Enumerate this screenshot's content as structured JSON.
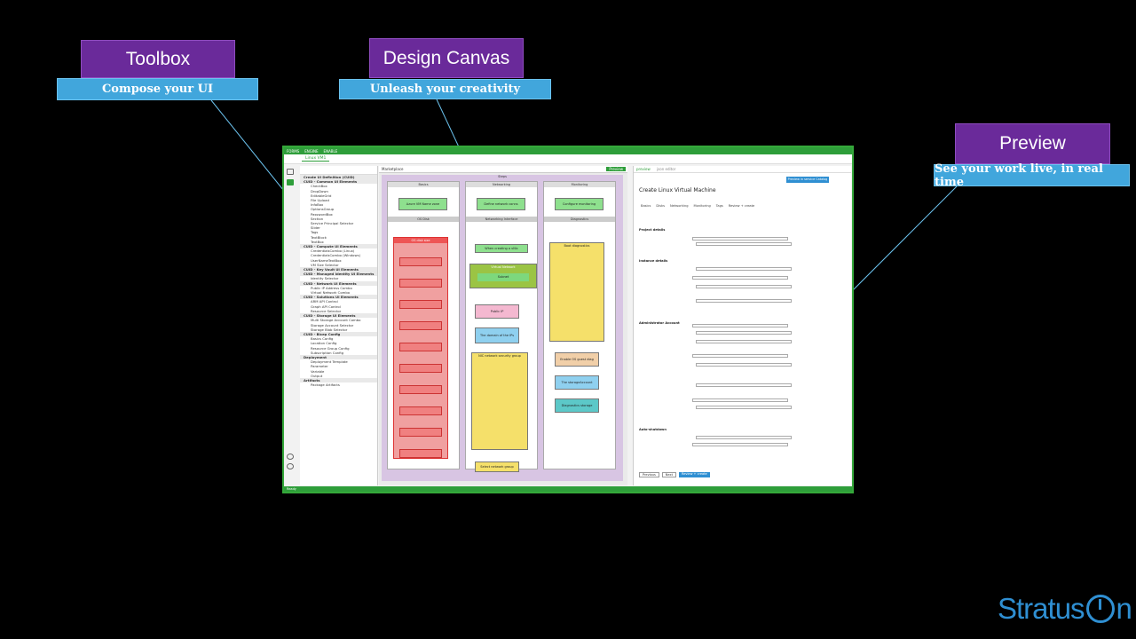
{
  "callouts": {
    "toolbox": {
      "title": "Toolbox",
      "subtitle": "Compose your UI"
    },
    "canvas": {
      "title": "Design Canvas",
      "subtitle": "Unleash your creativity"
    },
    "preview": {
      "title": "Preview",
      "subtitle": "See your work live, in real time"
    }
  },
  "app": {
    "title_bar": [
      "FORMS",
      "ENGINE",
      "ENABLE"
    ],
    "menu_tab": "Linux VM1",
    "toolbox_rows": [
      {
        "text": "Create UI Definition (CUID)",
        "cat": true
      },
      {
        "text": "CUID - Common UI Elements",
        "cat": true
      },
      {
        "text": "CheckBox",
        "cat": false
      },
      {
        "text": "DropDown",
        "cat": false
      },
      {
        "text": "EditableGrid",
        "cat": false
      },
      {
        "text": "File Upload",
        "cat": false
      },
      {
        "text": "InfoBox",
        "cat": false
      },
      {
        "text": "OptionsGroup",
        "cat": false
      },
      {
        "text": "PasswordBox",
        "cat": false
      },
      {
        "text": "Section",
        "cat": false
      },
      {
        "text": "Service Principal Selector",
        "cat": false
      },
      {
        "text": "Slider",
        "cat": false
      },
      {
        "text": "Tags",
        "cat": false
      },
      {
        "text": "TextBlock",
        "cat": false
      },
      {
        "text": "TextBox",
        "cat": false
      },
      {
        "text": "CUID - Compute UI Elements",
        "cat": true
      },
      {
        "text": "CredentialsCombo (Linux)",
        "cat": false
      },
      {
        "text": "CredentialsCombo (Windows)",
        "cat": false
      },
      {
        "text": "UserNameTextBox",
        "cat": false
      },
      {
        "text": "VM Size Selector",
        "cat": false
      },
      {
        "text": "CUID - Key Vault UI Elements",
        "cat": true
      },
      {
        "text": "CUID - Managed Identity UI Elements",
        "cat": true
      },
      {
        "text": "Identity Selector",
        "cat": false
      },
      {
        "text": "CUID - Network UI Elements",
        "cat": true
      },
      {
        "text": "Public IP Address Combo",
        "cat": false
      },
      {
        "text": "Virtual Network Combo",
        "cat": false
      },
      {
        "text": "CUID - Solutions UI Elements",
        "cat": true
      },
      {
        "text": "ARM API Control",
        "cat": false
      },
      {
        "text": "Graph API Control",
        "cat": false
      },
      {
        "text": "Resource Selector",
        "cat": false
      },
      {
        "text": "CUID - Storage UI Elements",
        "cat": true
      },
      {
        "text": "Multi Storage Account Combo",
        "cat": false
      },
      {
        "text": "Storage Account Selector",
        "cat": false
      },
      {
        "text": "Storage Blob Selector",
        "cat": false
      },
      {
        "text": "CUID - Bicep Config",
        "cat": true
      },
      {
        "text": "Basics Config",
        "cat": false
      },
      {
        "text": "Location Config",
        "cat": false
      },
      {
        "text": "Resource Group Config",
        "cat": false
      },
      {
        "text": "Subscription Config",
        "cat": false
      },
      {
        "text": "Deployment",
        "cat": true
      },
      {
        "text": "Deployment Template",
        "cat": false
      },
      {
        "text": "Parameter",
        "cat": false
      },
      {
        "text": "Variable",
        "cat": false
      },
      {
        "text": "Output",
        "cat": false
      },
      {
        "text": "Artifacts",
        "cat": true
      },
      {
        "text": "Package Artifacts",
        "cat": false
      }
    ],
    "canvas_toolbar": "Marketplace",
    "canvas_header": "Steps",
    "lanes": [
      {
        "header": "Basics",
        "step": "Azure VM Name zone",
        "group": "OS Disk",
        "inner": "OS disk size"
      },
      {
        "header": "Networking",
        "step": "Define network conns",
        "group": "Networking Interface",
        "inner": "Virtual Network"
      },
      {
        "header": "Monitoring",
        "step": "Configure monitoring",
        "group": "Diagnostics",
        "inner": "Boot diagnostics"
      }
    ],
    "net_boxes": [
      "When creating a vNic",
      "Subnet",
      "Public IP",
      "The domain of the IPs",
      "NIC network security group"
    ],
    "diag_boxes": [
      "Enable OS guest diag",
      "The storageAccount",
      "Diagnostics storage"
    ],
    "red_box_last": "OS disk size",
    "yellow_last": "Select network group",
    "preview_tabs": [
      "preview",
      "json editor"
    ],
    "preview_title": "Create Linux Virtual Machine",
    "preview_steps": [
      "Basics",
      "Disks",
      "Networking",
      "Monitoring",
      "Tags",
      "Review + create"
    ],
    "preview_sections": [
      "Project details",
      "Instance details",
      "Administrator Account",
      "Auto-shutdown"
    ],
    "preview_buttons": [
      "Previous",
      "Next",
      "Review + create"
    ],
    "preview_action": "Preview in service Catalog",
    "status": "Ready"
  },
  "brand": {
    "left": "Stratus",
    "right": "n"
  }
}
